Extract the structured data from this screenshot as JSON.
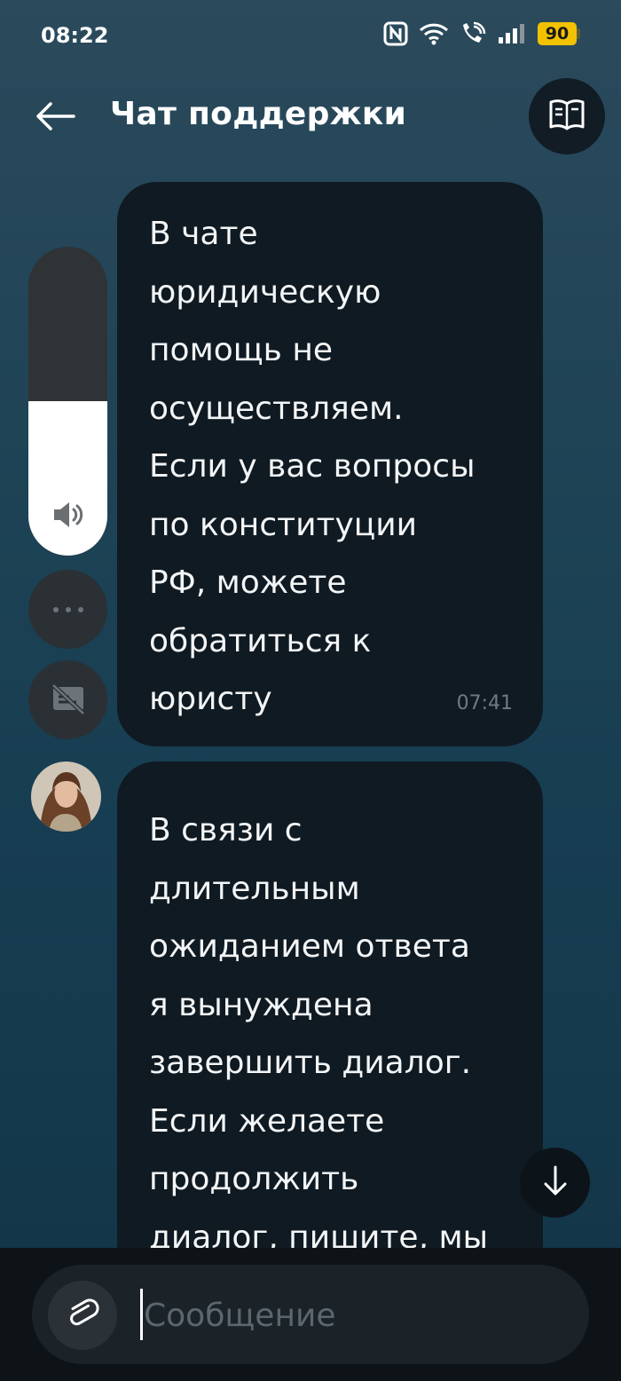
{
  "status_bar": {
    "time": "08:22",
    "battery_level": "90",
    "icons": [
      "nfc-icon",
      "wifi-icon",
      "wifi-call-icon",
      "signal-icon",
      "battery-icon"
    ]
  },
  "header": {
    "title": "Чат поддержки",
    "back_icon": "arrow-left-icon",
    "action_icon": "book-icon"
  },
  "messages": [
    {
      "text": "В чате\nюридическую\nпомощь не\nосуществляем.\nЕсли у вас вопросы\nпо конституции\nРФ, можете\nобратиться к\nюристу",
      "time": "07:41"
    },
    {
      "text": "В связи с\nдлительным\nожиданием ответа\nя вынуждена\nзавершить диалог.\nЕсли желаете\nпродолжить\nдиалог, пишите, мы",
      "avatar": "agent-avatar"
    }
  ],
  "volume_panel": {
    "level": 0.5,
    "speaker_icon": "speaker-icon",
    "more_icon": "more-dots-icon",
    "captions_icon": "captions-off-icon"
  },
  "composer": {
    "placeholder": "Сообщение",
    "value": "",
    "attach_icon": "paperclip-icon",
    "scroll_icon": "arrow-down-icon"
  },
  "colors": {
    "bubble": "#101a22",
    "battery": "#f2c200",
    "background_top": "#2b4a5c",
    "background_bottom": "#123446"
  }
}
